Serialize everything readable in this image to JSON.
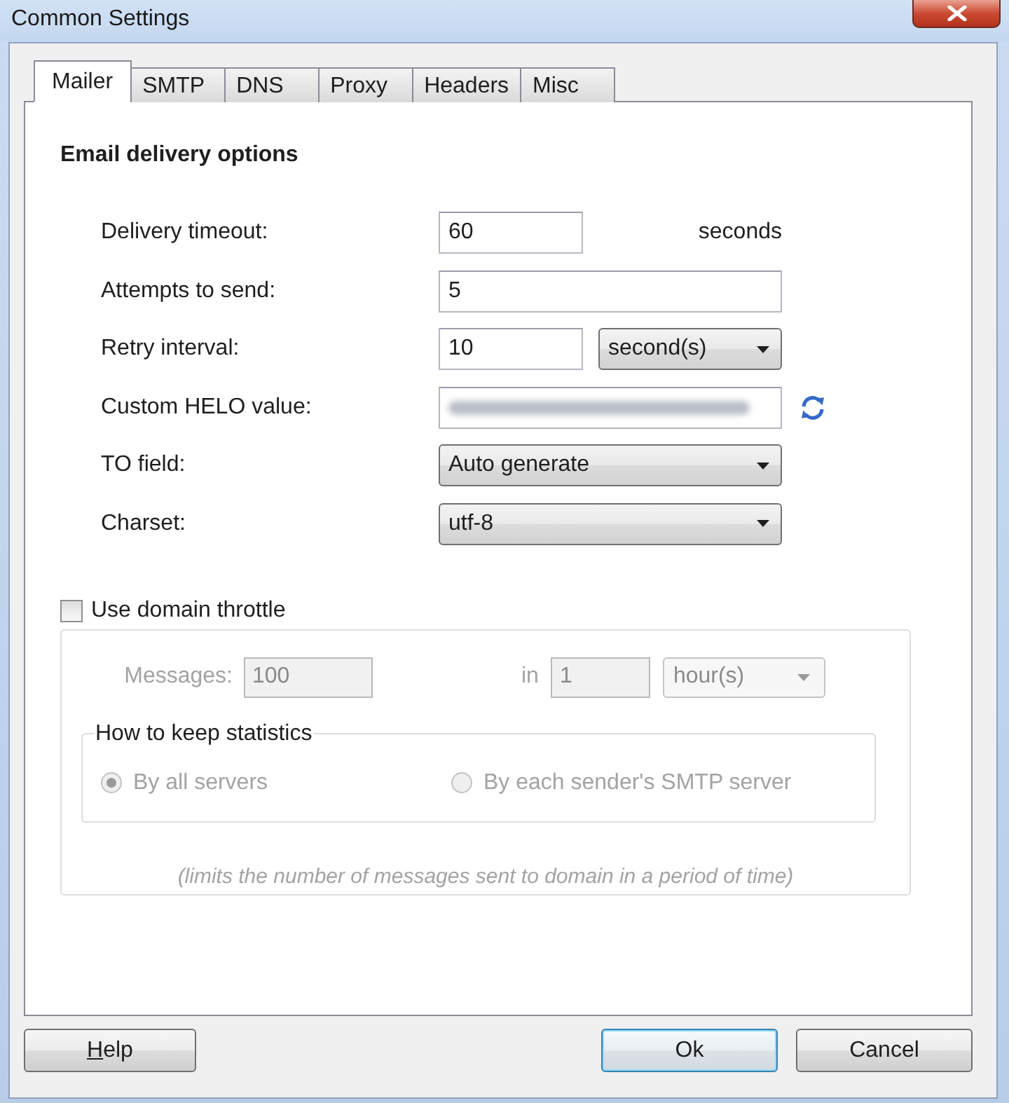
{
  "window": {
    "title": "Common Settings"
  },
  "tabs": [
    {
      "label": "Mailer",
      "selected": true
    },
    {
      "label": "SMTP",
      "selected": false
    },
    {
      "label": "DNS",
      "selected": false
    },
    {
      "label": "Proxy",
      "selected": false
    },
    {
      "label": "Headers",
      "selected": false
    },
    {
      "label": "Misc",
      "selected": false
    }
  ],
  "section_title": "Email delivery options",
  "rows": [
    {
      "kind": "text_unit",
      "label": "Delivery timeout:",
      "value": "60",
      "unit": "seconds"
    },
    {
      "kind": "text",
      "label": "Attempts to send:",
      "value": "5"
    },
    {
      "kind": "text_select",
      "label": "Retry interval:",
      "value": "10",
      "option": "second(s)"
    },
    {
      "kind": "redacted",
      "label": "Custom HELO value:"
    },
    {
      "kind": "select",
      "label": "TO field:",
      "value": "Auto generate"
    },
    {
      "kind": "select",
      "label": "Charset:",
      "value": "utf-8"
    }
  ],
  "throttle": {
    "label": "Use domain throttle",
    "checked": false,
    "messages_label": "Messages:",
    "messages_value": "100",
    "in_label": "in",
    "period_value": "1",
    "period_unit": "hour(s)",
    "statistics": {
      "title": "How to keep statistics",
      "options": [
        {
          "label": "By all servers",
          "selected": true
        },
        {
          "label": "By each sender's SMTP server",
          "selected": false
        }
      ]
    },
    "note": "(limits the number of messages sent to domain in a period of time)"
  },
  "footer": {
    "help": {
      "label": "Help",
      "mnemonic_underlined": true
    },
    "buttons": [
      {
        "label": "Ok",
        "default": true
      },
      {
        "label": "Cancel",
        "default": false
      }
    ]
  }
}
